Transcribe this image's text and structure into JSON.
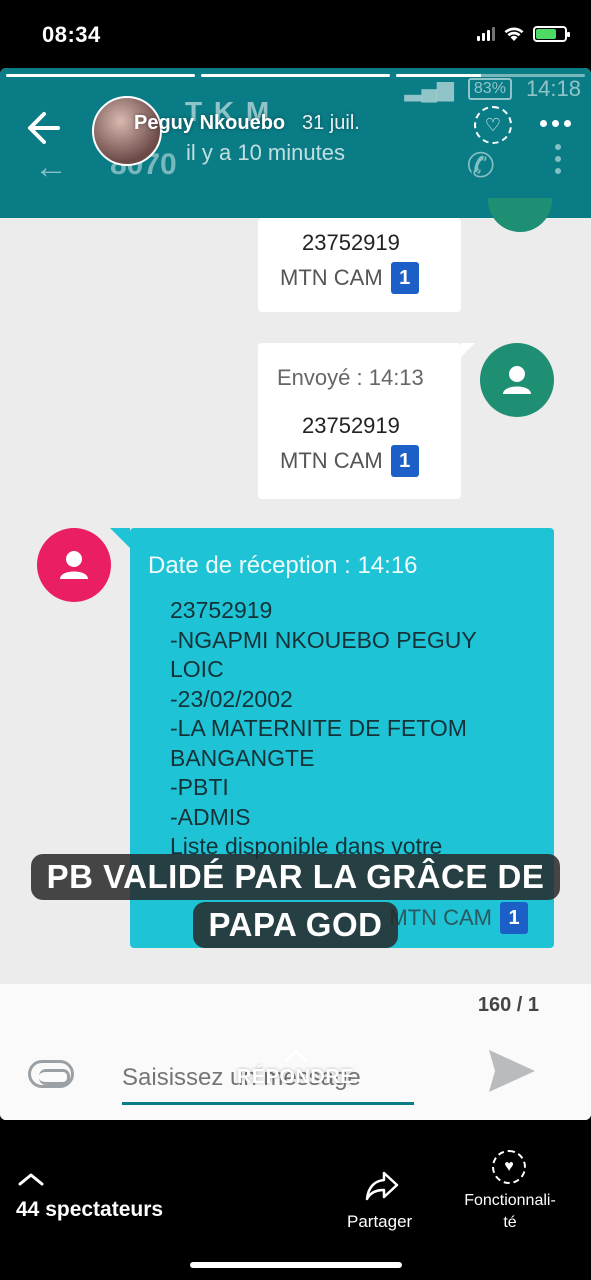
{
  "status_bar": {
    "time": "08:34",
    "battery_percent": 0.7
  },
  "story": {
    "progress_segments": [
      1.0,
      1.0,
      0.45
    ],
    "user_name": "Peguy Nkouebo",
    "date": "31 juil.",
    "icons": {
      "back": "back-arrow-icon",
      "heart": "heart-icon",
      "more": "more-dots-icon"
    }
  },
  "sms_app": {
    "title": "T K M",
    "sender_number": "8070",
    "time_ago": "il y a 10 minutes",
    "status_battery": "83%",
    "status_time": "14:18",
    "messages": [
      {
        "number": "23752919",
        "sim": "MTN CAM",
        "sim_index": "1"
      },
      {
        "meta": "Envoyé : 14:13",
        "number": "23752919",
        "sim": "MTN CAM",
        "sim_index": "1"
      },
      {
        "meta": "Date de réception : 14:16",
        "body": "23752919\n-NGAPMI NKOUEBO PEGUY\nLOIC\n-23/02/2002\n-LA MATERNITE DE FETOM\nBANGANGTE\n-PBTI\n-ADMIS\nListe disponible dans votre",
        "sim": "MTN CAM",
        "sim_index": "1"
      }
    ],
    "char_count": "160 / 1",
    "input_placeholder": "Saisissez un message",
    "colors": {
      "header": "#0a7c86",
      "incoming": "#1ec4d6",
      "avatar_green": "#1f8f74",
      "avatar_pink": "#e91e63"
    }
  },
  "caption": {
    "line1": "PB VALIDÉ PAR LA GRÂCE DE",
    "line2": "PAPA GOD"
  },
  "reply_label": "RÉPONDRE",
  "bottom_bar": {
    "viewers": "44 spectateurs",
    "share": "Partager",
    "features": "Fonctionnali-\nté"
  }
}
